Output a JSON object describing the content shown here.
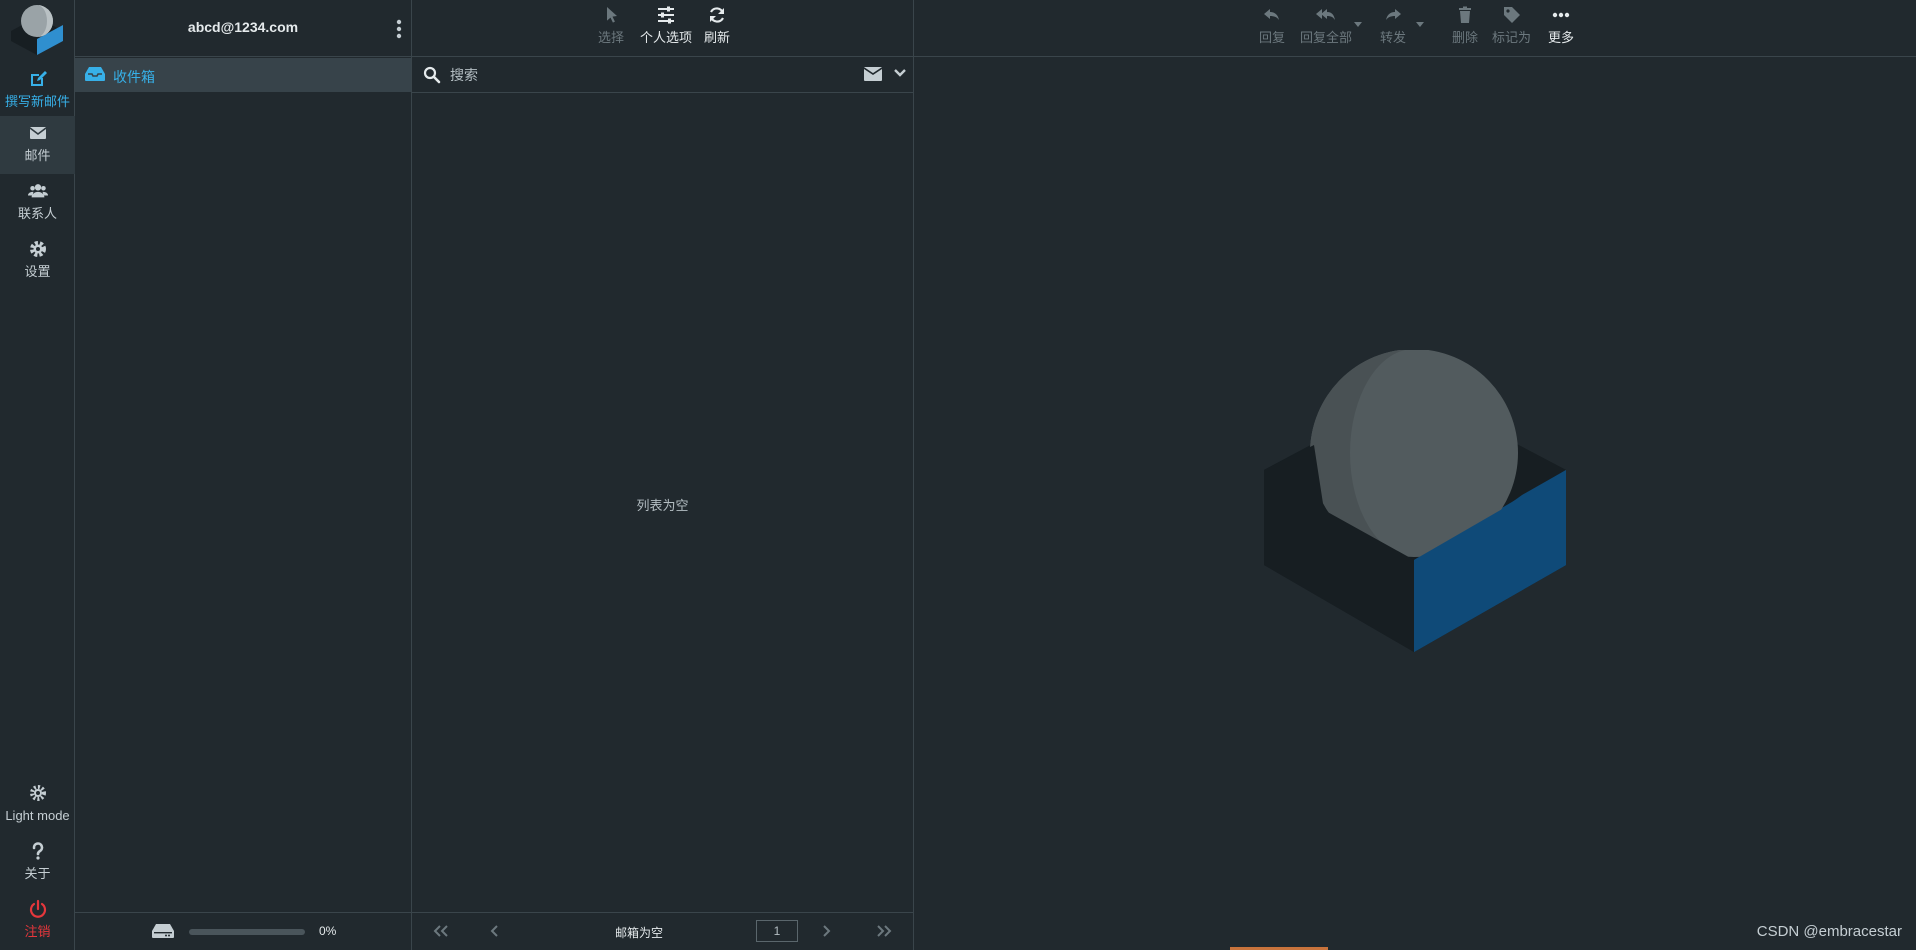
{
  "rail": {
    "compose": "撰写新邮件",
    "mail": "邮件",
    "contacts": "联系人",
    "settings": "设置",
    "light_mode": "Light mode",
    "about": "关于",
    "logout": "注销"
  },
  "account": {
    "email": "abcd@1234.com"
  },
  "folders": [
    {
      "name": "收件箱",
      "icon": "inbox-icon"
    }
  ],
  "quota": {
    "percent_text": "0%",
    "used_fraction": 0
  },
  "list_toolbar": {
    "select": "选择",
    "options": "个人选项",
    "refresh": "刷新"
  },
  "search": {
    "placeholder": "搜索",
    "value": ""
  },
  "list": {
    "empty_message": "列表为空"
  },
  "pager": {
    "status": "邮箱为空",
    "page": "1"
  },
  "content_toolbar": {
    "reply": "回复",
    "reply_all": "回复全部",
    "forward": "转发",
    "delete": "删除",
    "mark": "标记为",
    "more": "更多"
  },
  "watermark": "CSDN @embracestar",
  "colors": {
    "background": "#21292e",
    "accent": "#37b0e8",
    "danger": "#e5373c",
    "selected_folder_bg": "#37434a",
    "logo_blue": "#0f4a78",
    "logo_dark": "#171e22",
    "logo_gray": "#525b5e"
  }
}
